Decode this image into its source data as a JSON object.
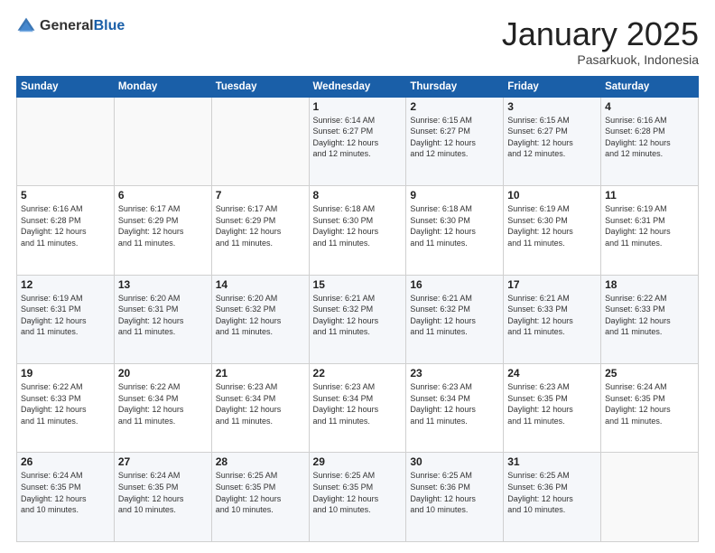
{
  "header": {
    "logo_general": "General",
    "logo_blue": "Blue",
    "title": "January 2025",
    "location": "Pasarkuok, Indonesia"
  },
  "calendar": {
    "days_of_week": [
      "Sunday",
      "Monday",
      "Tuesday",
      "Wednesday",
      "Thursday",
      "Friday",
      "Saturday"
    ],
    "weeks": [
      [
        {
          "day": "",
          "detail": ""
        },
        {
          "day": "",
          "detail": ""
        },
        {
          "day": "",
          "detail": ""
        },
        {
          "day": "1",
          "detail": "Sunrise: 6:14 AM\nSunset: 6:27 PM\nDaylight: 12 hours\nand 12 minutes."
        },
        {
          "day": "2",
          "detail": "Sunrise: 6:15 AM\nSunset: 6:27 PM\nDaylight: 12 hours\nand 12 minutes."
        },
        {
          "day": "3",
          "detail": "Sunrise: 6:15 AM\nSunset: 6:27 PM\nDaylight: 12 hours\nand 12 minutes."
        },
        {
          "day": "4",
          "detail": "Sunrise: 6:16 AM\nSunset: 6:28 PM\nDaylight: 12 hours\nand 12 minutes."
        }
      ],
      [
        {
          "day": "5",
          "detail": "Sunrise: 6:16 AM\nSunset: 6:28 PM\nDaylight: 12 hours\nand 11 minutes."
        },
        {
          "day": "6",
          "detail": "Sunrise: 6:17 AM\nSunset: 6:29 PM\nDaylight: 12 hours\nand 11 minutes."
        },
        {
          "day": "7",
          "detail": "Sunrise: 6:17 AM\nSunset: 6:29 PM\nDaylight: 12 hours\nand 11 minutes."
        },
        {
          "day": "8",
          "detail": "Sunrise: 6:18 AM\nSunset: 6:30 PM\nDaylight: 12 hours\nand 11 minutes."
        },
        {
          "day": "9",
          "detail": "Sunrise: 6:18 AM\nSunset: 6:30 PM\nDaylight: 12 hours\nand 11 minutes."
        },
        {
          "day": "10",
          "detail": "Sunrise: 6:19 AM\nSunset: 6:30 PM\nDaylight: 12 hours\nand 11 minutes."
        },
        {
          "day": "11",
          "detail": "Sunrise: 6:19 AM\nSunset: 6:31 PM\nDaylight: 12 hours\nand 11 minutes."
        }
      ],
      [
        {
          "day": "12",
          "detail": "Sunrise: 6:19 AM\nSunset: 6:31 PM\nDaylight: 12 hours\nand 11 minutes."
        },
        {
          "day": "13",
          "detail": "Sunrise: 6:20 AM\nSunset: 6:31 PM\nDaylight: 12 hours\nand 11 minutes."
        },
        {
          "day": "14",
          "detail": "Sunrise: 6:20 AM\nSunset: 6:32 PM\nDaylight: 12 hours\nand 11 minutes."
        },
        {
          "day": "15",
          "detail": "Sunrise: 6:21 AM\nSunset: 6:32 PM\nDaylight: 12 hours\nand 11 minutes."
        },
        {
          "day": "16",
          "detail": "Sunrise: 6:21 AM\nSunset: 6:32 PM\nDaylight: 12 hours\nand 11 minutes."
        },
        {
          "day": "17",
          "detail": "Sunrise: 6:21 AM\nSunset: 6:33 PM\nDaylight: 12 hours\nand 11 minutes."
        },
        {
          "day": "18",
          "detail": "Sunrise: 6:22 AM\nSunset: 6:33 PM\nDaylight: 12 hours\nand 11 minutes."
        }
      ],
      [
        {
          "day": "19",
          "detail": "Sunrise: 6:22 AM\nSunset: 6:33 PM\nDaylight: 12 hours\nand 11 minutes."
        },
        {
          "day": "20",
          "detail": "Sunrise: 6:22 AM\nSunset: 6:34 PM\nDaylight: 12 hours\nand 11 minutes."
        },
        {
          "day": "21",
          "detail": "Sunrise: 6:23 AM\nSunset: 6:34 PM\nDaylight: 12 hours\nand 11 minutes."
        },
        {
          "day": "22",
          "detail": "Sunrise: 6:23 AM\nSunset: 6:34 PM\nDaylight: 12 hours\nand 11 minutes."
        },
        {
          "day": "23",
          "detail": "Sunrise: 6:23 AM\nSunset: 6:34 PM\nDaylight: 12 hours\nand 11 minutes."
        },
        {
          "day": "24",
          "detail": "Sunrise: 6:23 AM\nSunset: 6:35 PM\nDaylight: 12 hours\nand 11 minutes."
        },
        {
          "day": "25",
          "detail": "Sunrise: 6:24 AM\nSunset: 6:35 PM\nDaylight: 12 hours\nand 11 minutes."
        }
      ],
      [
        {
          "day": "26",
          "detail": "Sunrise: 6:24 AM\nSunset: 6:35 PM\nDaylight: 12 hours\nand 10 minutes."
        },
        {
          "day": "27",
          "detail": "Sunrise: 6:24 AM\nSunset: 6:35 PM\nDaylight: 12 hours\nand 10 minutes."
        },
        {
          "day": "28",
          "detail": "Sunrise: 6:25 AM\nSunset: 6:35 PM\nDaylight: 12 hours\nand 10 minutes."
        },
        {
          "day": "29",
          "detail": "Sunrise: 6:25 AM\nSunset: 6:35 PM\nDaylight: 12 hours\nand 10 minutes."
        },
        {
          "day": "30",
          "detail": "Sunrise: 6:25 AM\nSunset: 6:36 PM\nDaylight: 12 hours\nand 10 minutes."
        },
        {
          "day": "31",
          "detail": "Sunrise: 6:25 AM\nSunset: 6:36 PM\nDaylight: 12 hours\nand 10 minutes."
        },
        {
          "day": "",
          "detail": ""
        }
      ]
    ]
  }
}
